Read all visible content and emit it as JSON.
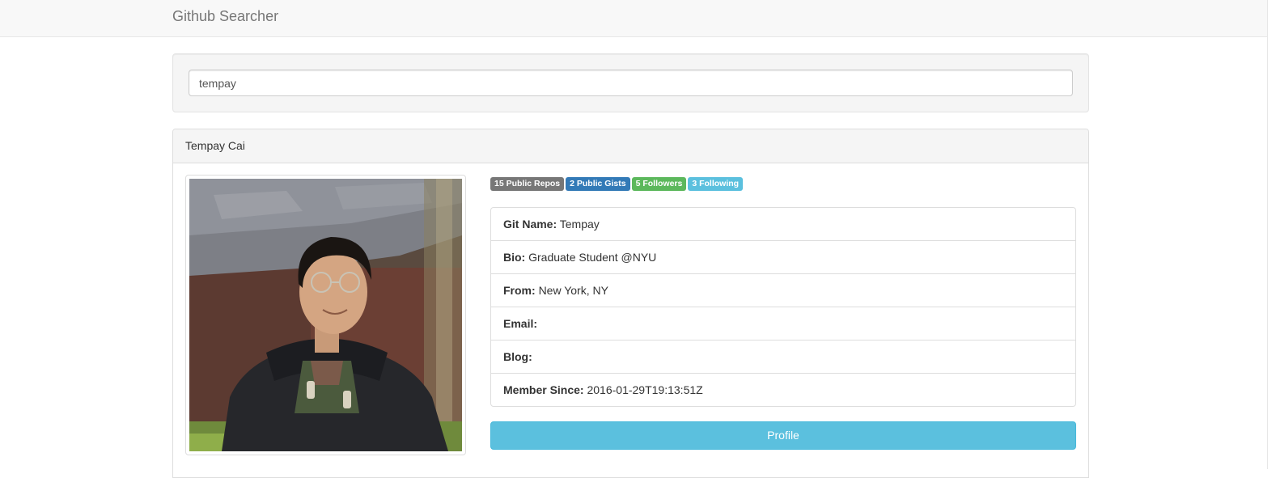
{
  "navbar": {
    "brand": "Github Searcher"
  },
  "search": {
    "value": "tempay",
    "placeholder": ""
  },
  "profile": {
    "name": "Tempay Cai",
    "avatar_icon": "user-photo",
    "badges": [
      {
        "label": "15 Public Repos",
        "color": "#777777"
      },
      {
        "label": "2 Public Gists",
        "color": "#337ab7"
      },
      {
        "label": "5 Followers",
        "color": "#5cb85c"
      },
      {
        "label": "3 Following",
        "color": "#5bc0de"
      }
    ],
    "details": [
      {
        "label": "Git Name:",
        "value": "Tempay"
      },
      {
        "label": "Bio:",
        "value": "Graduate Student @NYU"
      },
      {
        "label": "From:",
        "value": "New York, NY"
      },
      {
        "label": "Email:",
        "value": ""
      },
      {
        "label": "Blog:",
        "value": ""
      },
      {
        "label": "Member Since:",
        "value": "2016-01-29T19:13:51Z"
      }
    ],
    "button_label": "Profile",
    "button_color": "#5bc0de"
  }
}
